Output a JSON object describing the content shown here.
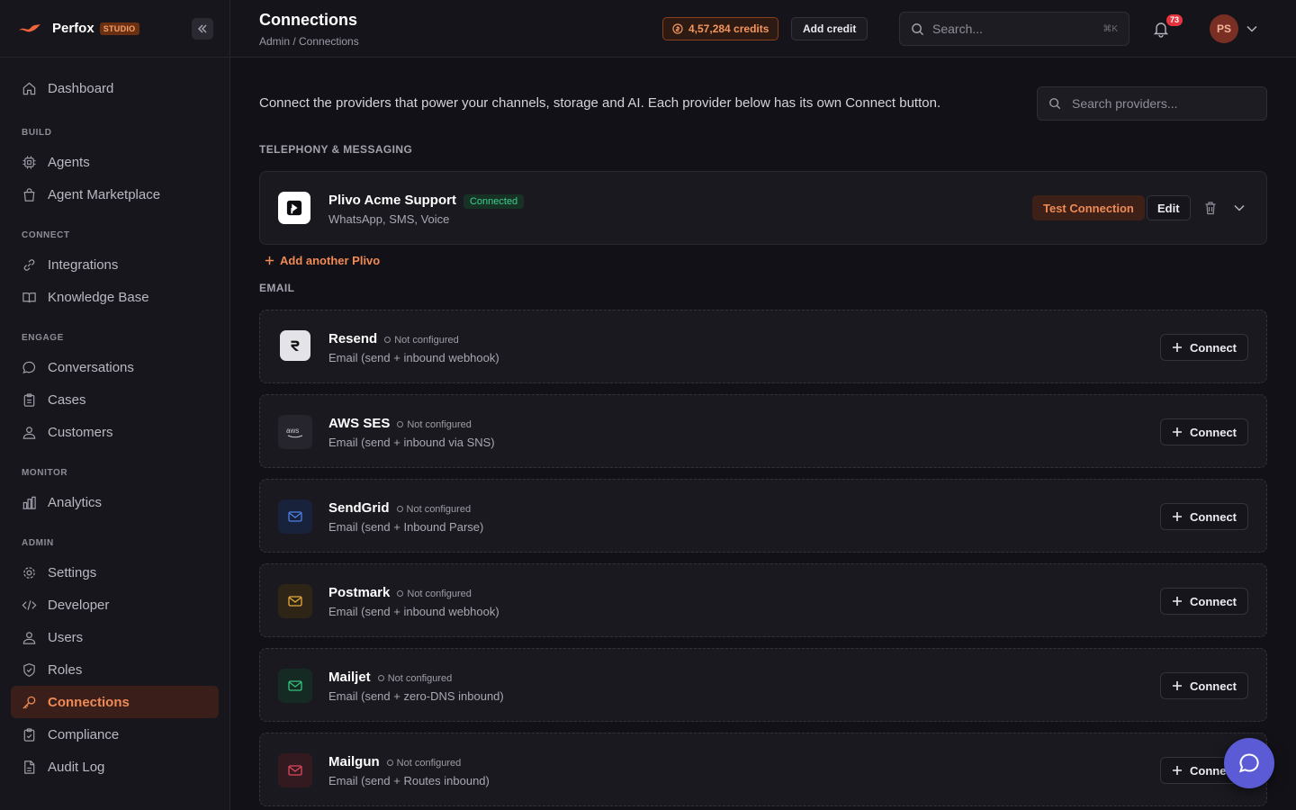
{
  "brand": {
    "name": "Perfox",
    "tag": "STUDIO"
  },
  "sidebar": {
    "top": [
      {
        "label": "Dashboard",
        "icon": "home-icon"
      }
    ],
    "sections": [
      {
        "title": "BUILD",
        "items": [
          {
            "label": "Agents",
            "icon": "cpu-icon"
          },
          {
            "label": "Agent Marketplace",
            "icon": "shopping-bag-icon"
          }
        ]
      },
      {
        "title": "CONNECT",
        "items": [
          {
            "label": "Integrations",
            "icon": "link-icon"
          },
          {
            "label": "Knowledge Base",
            "icon": "book-icon"
          }
        ]
      },
      {
        "title": "ENGAGE",
        "items": [
          {
            "label": "Conversations",
            "icon": "chat-icon"
          },
          {
            "label": "Cases",
            "icon": "clipboard-icon"
          },
          {
            "label": "Customers",
            "icon": "users-icon"
          }
        ]
      },
      {
        "title": "MONITOR",
        "items": [
          {
            "label": "Analytics",
            "icon": "bar-chart-icon"
          }
        ]
      },
      {
        "title": "ADMIN",
        "items": [
          {
            "label": "Settings",
            "icon": "gear-icon"
          },
          {
            "label": "Developer",
            "icon": "code-icon"
          },
          {
            "label": "Users",
            "icon": "user-icon"
          },
          {
            "label": "Roles",
            "icon": "shield-icon"
          },
          {
            "label": "Connections",
            "icon": "key-icon",
            "active": true
          },
          {
            "label": "Compliance",
            "icon": "clipboard-check-icon"
          },
          {
            "label": "Audit Log",
            "icon": "file-icon"
          }
        ]
      }
    ]
  },
  "header": {
    "title": "Connections",
    "breadcrumb": "Admin / Connections",
    "credits": "4,57,284 credits",
    "add_credit": "Add credit",
    "search_placeholder": "Search...",
    "search_shortcut": "⌘K",
    "notification_count": "73",
    "avatar_initials": "PS"
  },
  "main": {
    "intro": "Connect the providers that power your channels, storage and AI. Each provider below has its own Connect button.",
    "provider_search_placeholder": "Search providers...",
    "telephony": {
      "title": "TELEPHONY & MESSAGING",
      "card": {
        "name": "Plivo Acme Support",
        "status": "Connected",
        "desc": "WhatsApp, SMS, Voice",
        "test_label": "Test Connection",
        "edit_label": "Edit"
      },
      "add_another": "Add another Plivo"
    },
    "email": {
      "title": "EMAIL",
      "connect_label": "Connect",
      "providers": [
        {
          "name": "Resend",
          "status": "Not configured",
          "desc": "Email (send + inbound webhook)"
        },
        {
          "name": "AWS SES",
          "status": "Not configured",
          "desc": "Email (send + inbound via SNS)"
        },
        {
          "name": "SendGrid",
          "status": "Not configured",
          "desc": "Email (send + Inbound Parse)"
        },
        {
          "name": "Postmark",
          "status": "Not configured",
          "desc": "Email (send + inbound webhook)"
        },
        {
          "name": "Mailjet",
          "status": "Not configured",
          "desc": "Email (send + zero-DNS inbound)"
        },
        {
          "name": "Mailgun",
          "status": "Not configured",
          "desc": "Email (send + Routes inbound)"
        }
      ]
    }
  },
  "colors": {
    "accent": "#f08a54",
    "connected": "#3fcf8e",
    "fab": "#5b5bd6"
  }
}
